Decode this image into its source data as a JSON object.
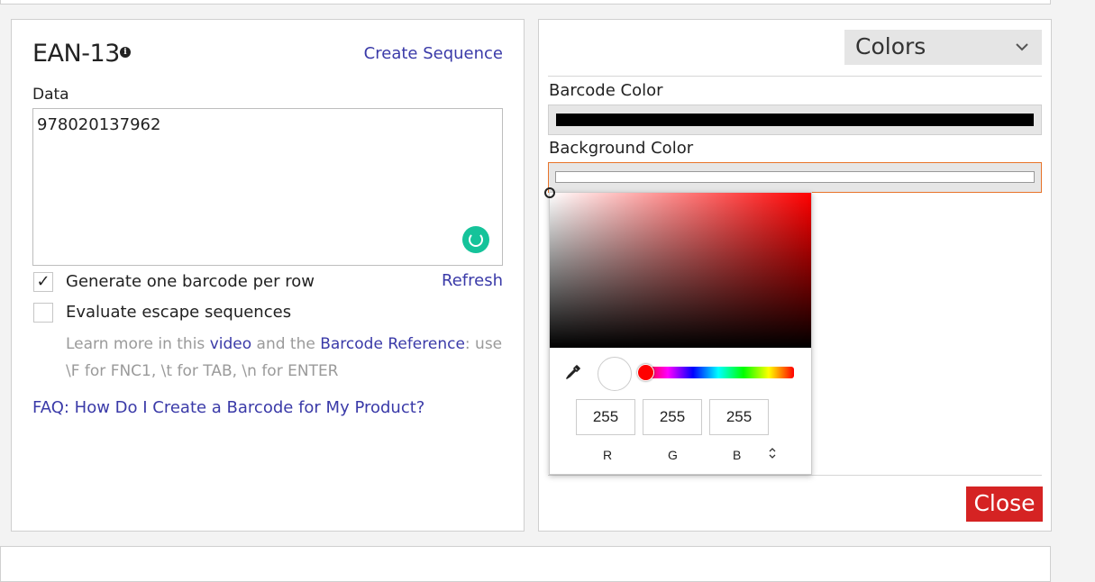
{
  "left": {
    "title": "EAN-13",
    "info_icon": "info-icon",
    "create_sequence": "Create Sequence",
    "data_label": "Data",
    "data_value": "978020137962",
    "refresh": "Refresh",
    "checkbox_generate": {
      "label": "Generate one barcode per row",
      "checked": true,
      "mark": "✓"
    },
    "checkbox_escape": {
      "label": "Evaluate escape sequences",
      "checked": false
    },
    "help": {
      "prefix": "Learn more in this ",
      "video_link": "video",
      "middle": " and the ",
      "reference_link": "Barcode Reference",
      "suffix": ": use \\F for FNC1, \\t for TAB, \\n for ENTER"
    },
    "faq": "FAQ: How Do I Create a Barcode for My Product?"
  },
  "right": {
    "colors_select": "Colors",
    "barcode_color_label": "Barcode Color",
    "barcode_color": "#000000",
    "background_color_label": "Background Color",
    "background_color": "#ffffff",
    "close": "Close"
  },
  "picker": {
    "r": "255",
    "g": "255",
    "b": "255",
    "r_label": "R",
    "g_label": "G",
    "b_label": "B",
    "hue_color": "#ff0000"
  }
}
